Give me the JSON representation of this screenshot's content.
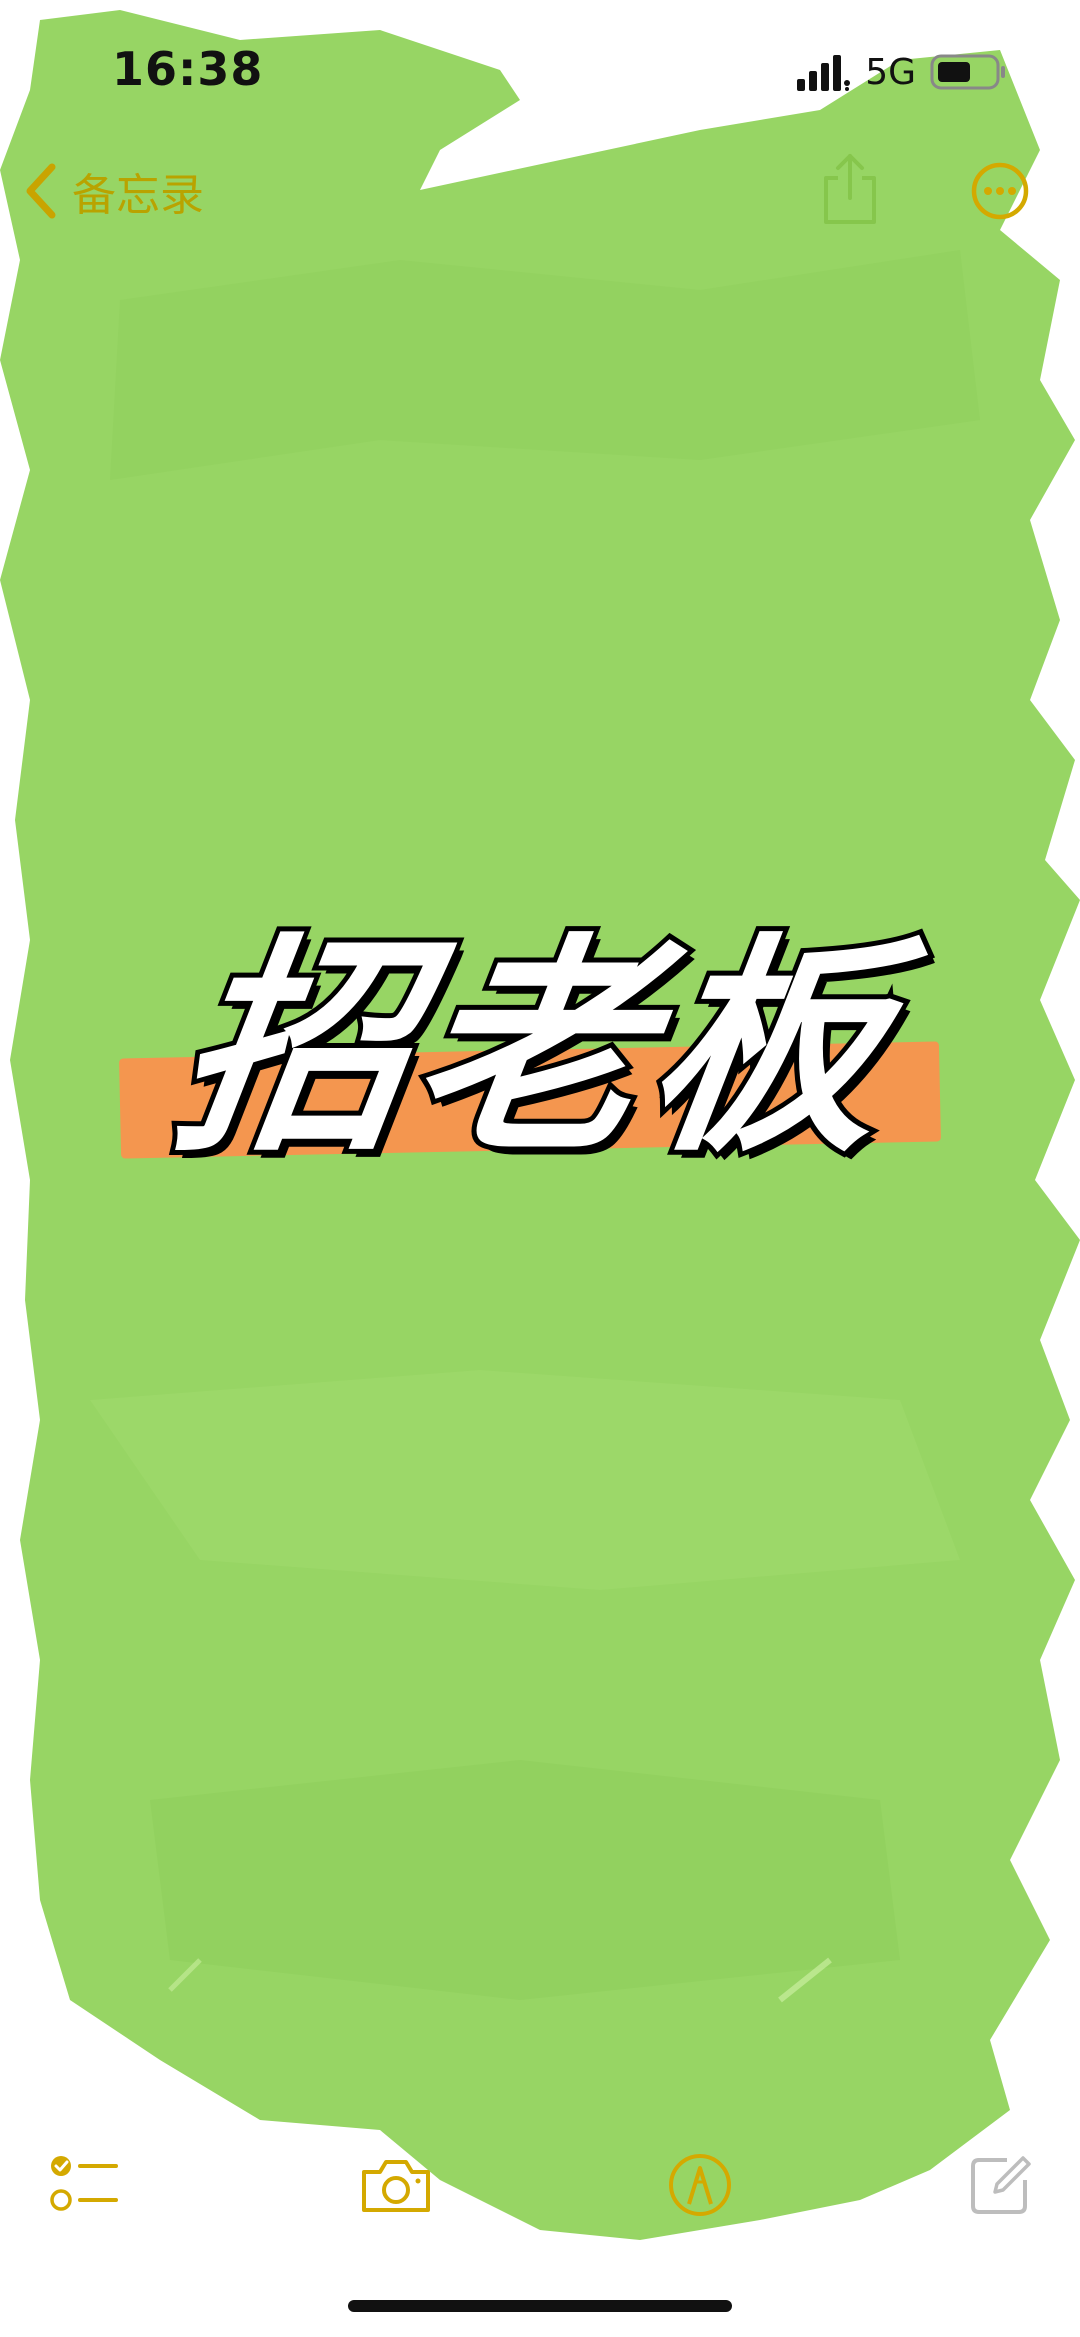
{
  "status_bar": {
    "time": "16:38",
    "network": "5G",
    "signal_icon": "cellular-signal-icon",
    "battery_icon": "battery-icon"
  },
  "nav": {
    "back_label": "备忘录",
    "back_icon": "chevron-left-icon",
    "share_icon": "share-icon",
    "more_icon": "more-options-icon"
  },
  "note": {
    "headline": "招老板"
  },
  "toolbar": {
    "checklist_icon": "checklist-icon",
    "camera_icon": "camera-icon",
    "markup_icon": "markup-pen-icon",
    "compose_icon": "compose-icon"
  },
  "colors": {
    "accent": "#d4a900",
    "paint_green": "#95d562",
    "highlight_orange": "#f4964f",
    "headline_fill": "#ffffff",
    "headline_stroke": "#000000"
  }
}
